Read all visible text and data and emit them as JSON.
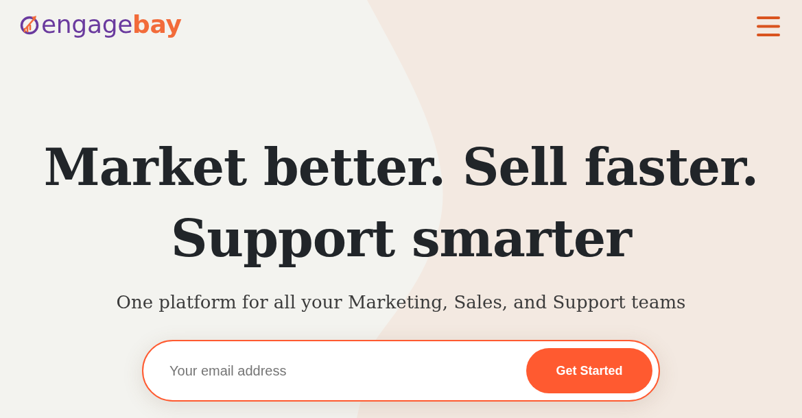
{
  "header": {
    "logo": {
      "word": "engage",
      "accent": "bay"
    }
  },
  "hero": {
    "headline": "Market better. Sell faster. Support smarter",
    "subtitle": "One platform for all your Marketing, Sales, and Support teams",
    "signup": {
      "placeholder": "Your email address",
      "button": "Get Started"
    }
  }
}
